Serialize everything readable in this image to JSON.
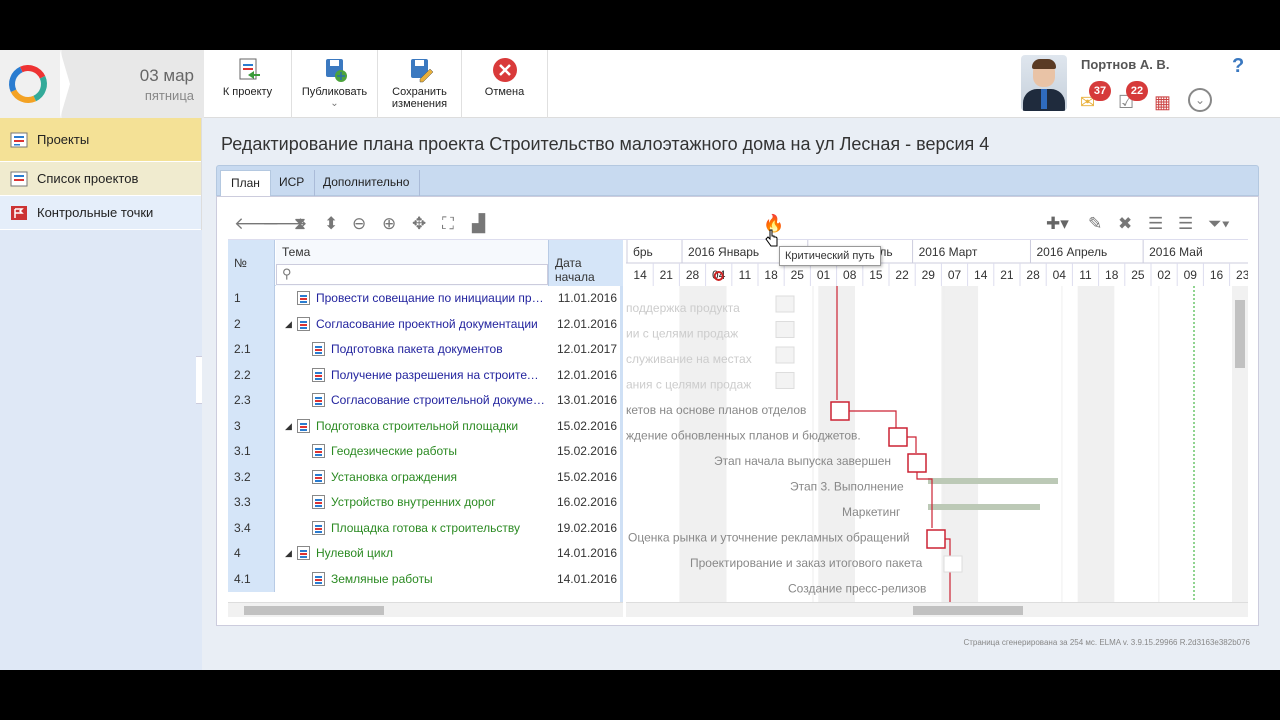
{
  "header": {
    "date_day": "03 мар",
    "date_weekday": "пятница",
    "toolbar": [
      {
        "label": "К проекту"
      },
      {
        "label": "Публиковать"
      },
      {
        "label": "Сохранить изменения"
      },
      {
        "label": "Отмена"
      }
    ],
    "user_name": "Портнов А. В.",
    "mail_count": "37",
    "tasks_count": "22",
    "help": "?"
  },
  "sidebar": {
    "items": [
      {
        "label": "Проекты",
        "icon": "projects-icon"
      },
      {
        "label": "Список проектов",
        "icon": "project-list-icon"
      },
      {
        "label": "Контрольные точки",
        "icon": "milestones-icon"
      }
    ]
  },
  "page": {
    "title": "Редактирование плана проекта Строительство малоэтажного дома на ул Лесная - версия 4",
    "tabs": [
      "План",
      "ИСР",
      "Дополнительно"
    ],
    "footer": "Страница сгенерирована за 254 мс. ELMA v. 3.9.15.29966 R.2d3163e382b076"
  },
  "grid": {
    "headers": {
      "no": "№",
      "topic": "Тема",
      "start": "Дата начала"
    },
    "rows": [
      {
        "no": "1",
        "topic": "Провести совещание по инициации прое...",
        "start": "11.01.2016",
        "level": 0,
        "group": false,
        "color": "blue"
      },
      {
        "no": "2",
        "topic": "Согласование проектной документации",
        "start": "12.01.2016",
        "level": 0,
        "group": true,
        "color": "blue"
      },
      {
        "no": "2.1",
        "topic": "Подготовка пакета документов",
        "start": "12.01.2017",
        "level": 1,
        "group": false,
        "color": "blue"
      },
      {
        "no": "2.2",
        "topic": "Получение разрешения на строитель...",
        "start": "12.01.2016",
        "level": 1,
        "group": false,
        "color": "blue"
      },
      {
        "no": "2.3",
        "topic": "Согласование строительной документ...",
        "start": "13.01.2016",
        "level": 1,
        "group": false,
        "color": "blue"
      },
      {
        "no": "3",
        "topic": "Подготовка строительной площадки",
        "start": "15.02.2016",
        "level": 0,
        "group": true,
        "color": "green"
      },
      {
        "no": "3.1",
        "topic": "Геодезические работы",
        "start": "15.02.2016",
        "level": 1,
        "group": false,
        "color": "green"
      },
      {
        "no": "3.2",
        "topic": "Установка ограждения",
        "start": "15.02.2016",
        "level": 1,
        "group": false,
        "color": "green"
      },
      {
        "no": "3.3",
        "topic": "Устройство внутренних дорог",
        "start": "16.02.2016",
        "level": 1,
        "group": false,
        "color": "green"
      },
      {
        "no": "3.4",
        "topic": "Площадка готова к строительству",
        "start": "19.02.2016",
        "level": 1,
        "group": false,
        "color": "green"
      },
      {
        "no": "4",
        "topic": "Нулевой цикл",
        "start": "14.01.2016",
        "level": 0,
        "group": true,
        "color": "green"
      },
      {
        "no": "4.1",
        "topic": "Земляные работы",
        "start": "14.01.2016",
        "level": 1,
        "group": false,
        "color": "green"
      }
    ]
  },
  "gantt": {
    "months": [
      "брь",
      "2016 Январь",
      "2016 Февраль",
      "2016 Март",
      "2016 Апрель",
      "2016 Май"
    ],
    "days": [
      "14",
      "21",
      "28",
      "04",
      "11",
      "18",
      "25",
      "01",
      "08",
      "15",
      "22",
      "29",
      "07",
      "14",
      "21",
      "28",
      "04",
      "11",
      "18",
      "25",
      "02",
      "09",
      "16",
      "23"
    ],
    "ghost_labels": [
      "поддержка продукта",
      "ии с целями продаж",
      "служивание на местах",
      "ания с целями продаж",
      "кетов на основе планов отделов",
      "ждение обновленных планов и бюджетов.",
      "Этап начала выпуска завершен",
      "Этап 3. Выполнение",
      "Маркетинг",
      "Оценка рынка и уточнение рекламных обращений",
      "Проектирование и заказ итогового пакета",
      "Создание пресс-релизов"
    ],
    "tooltip": "Критический путь",
    "critical_color": "#cc2233"
  }
}
